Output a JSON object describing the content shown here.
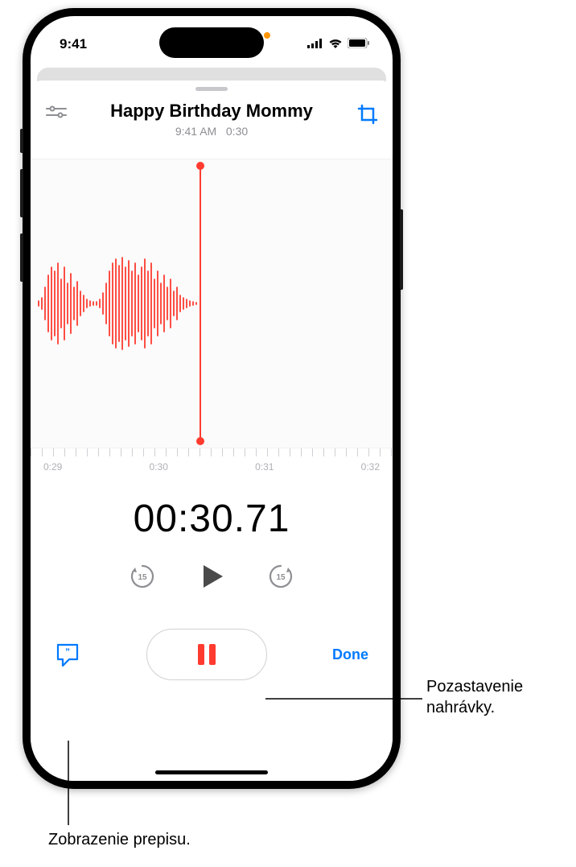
{
  "status": {
    "time": "9:41",
    "recording_indicator": "orange-dot"
  },
  "recording": {
    "title": "Happy Birthday Mommy",
    "meta_time": "9:41 AM",
    "meta_duration": "0:30"
  },
  "timeline": {
    "ticks": [
      "0:29",
      "0:30",
      "0:31",
      "0:32"
    ]
  },
  "playback": {
    "current_time": "00:30.71",
    "skip_back_seconds": "15",
    "skip_forward_seconds": "15"
  },
  "controls": {
    "done_label": "Done"
  },
  "icons": {
    "settings": "sliders-icon",
    "crop": "crop-icon",
    "skip_back": "skip-back-15-icon",
    "play": "play-icon",
    "skip_forward": "skip-forward-15-icon",
    "pause": "pause-icon",
    "transcript": "speech-quote-icon"
  },
  "callouts": {
    "pause": "Pozastavenie nahrávky.",
    "transcript": "Zobrazenie prepisu."
  },
  "colors": {
    "accent_red": "#ff3b30",
    "accent_blue": "#007aff",
    "gray_text": "#8e8e93"
  }
}
